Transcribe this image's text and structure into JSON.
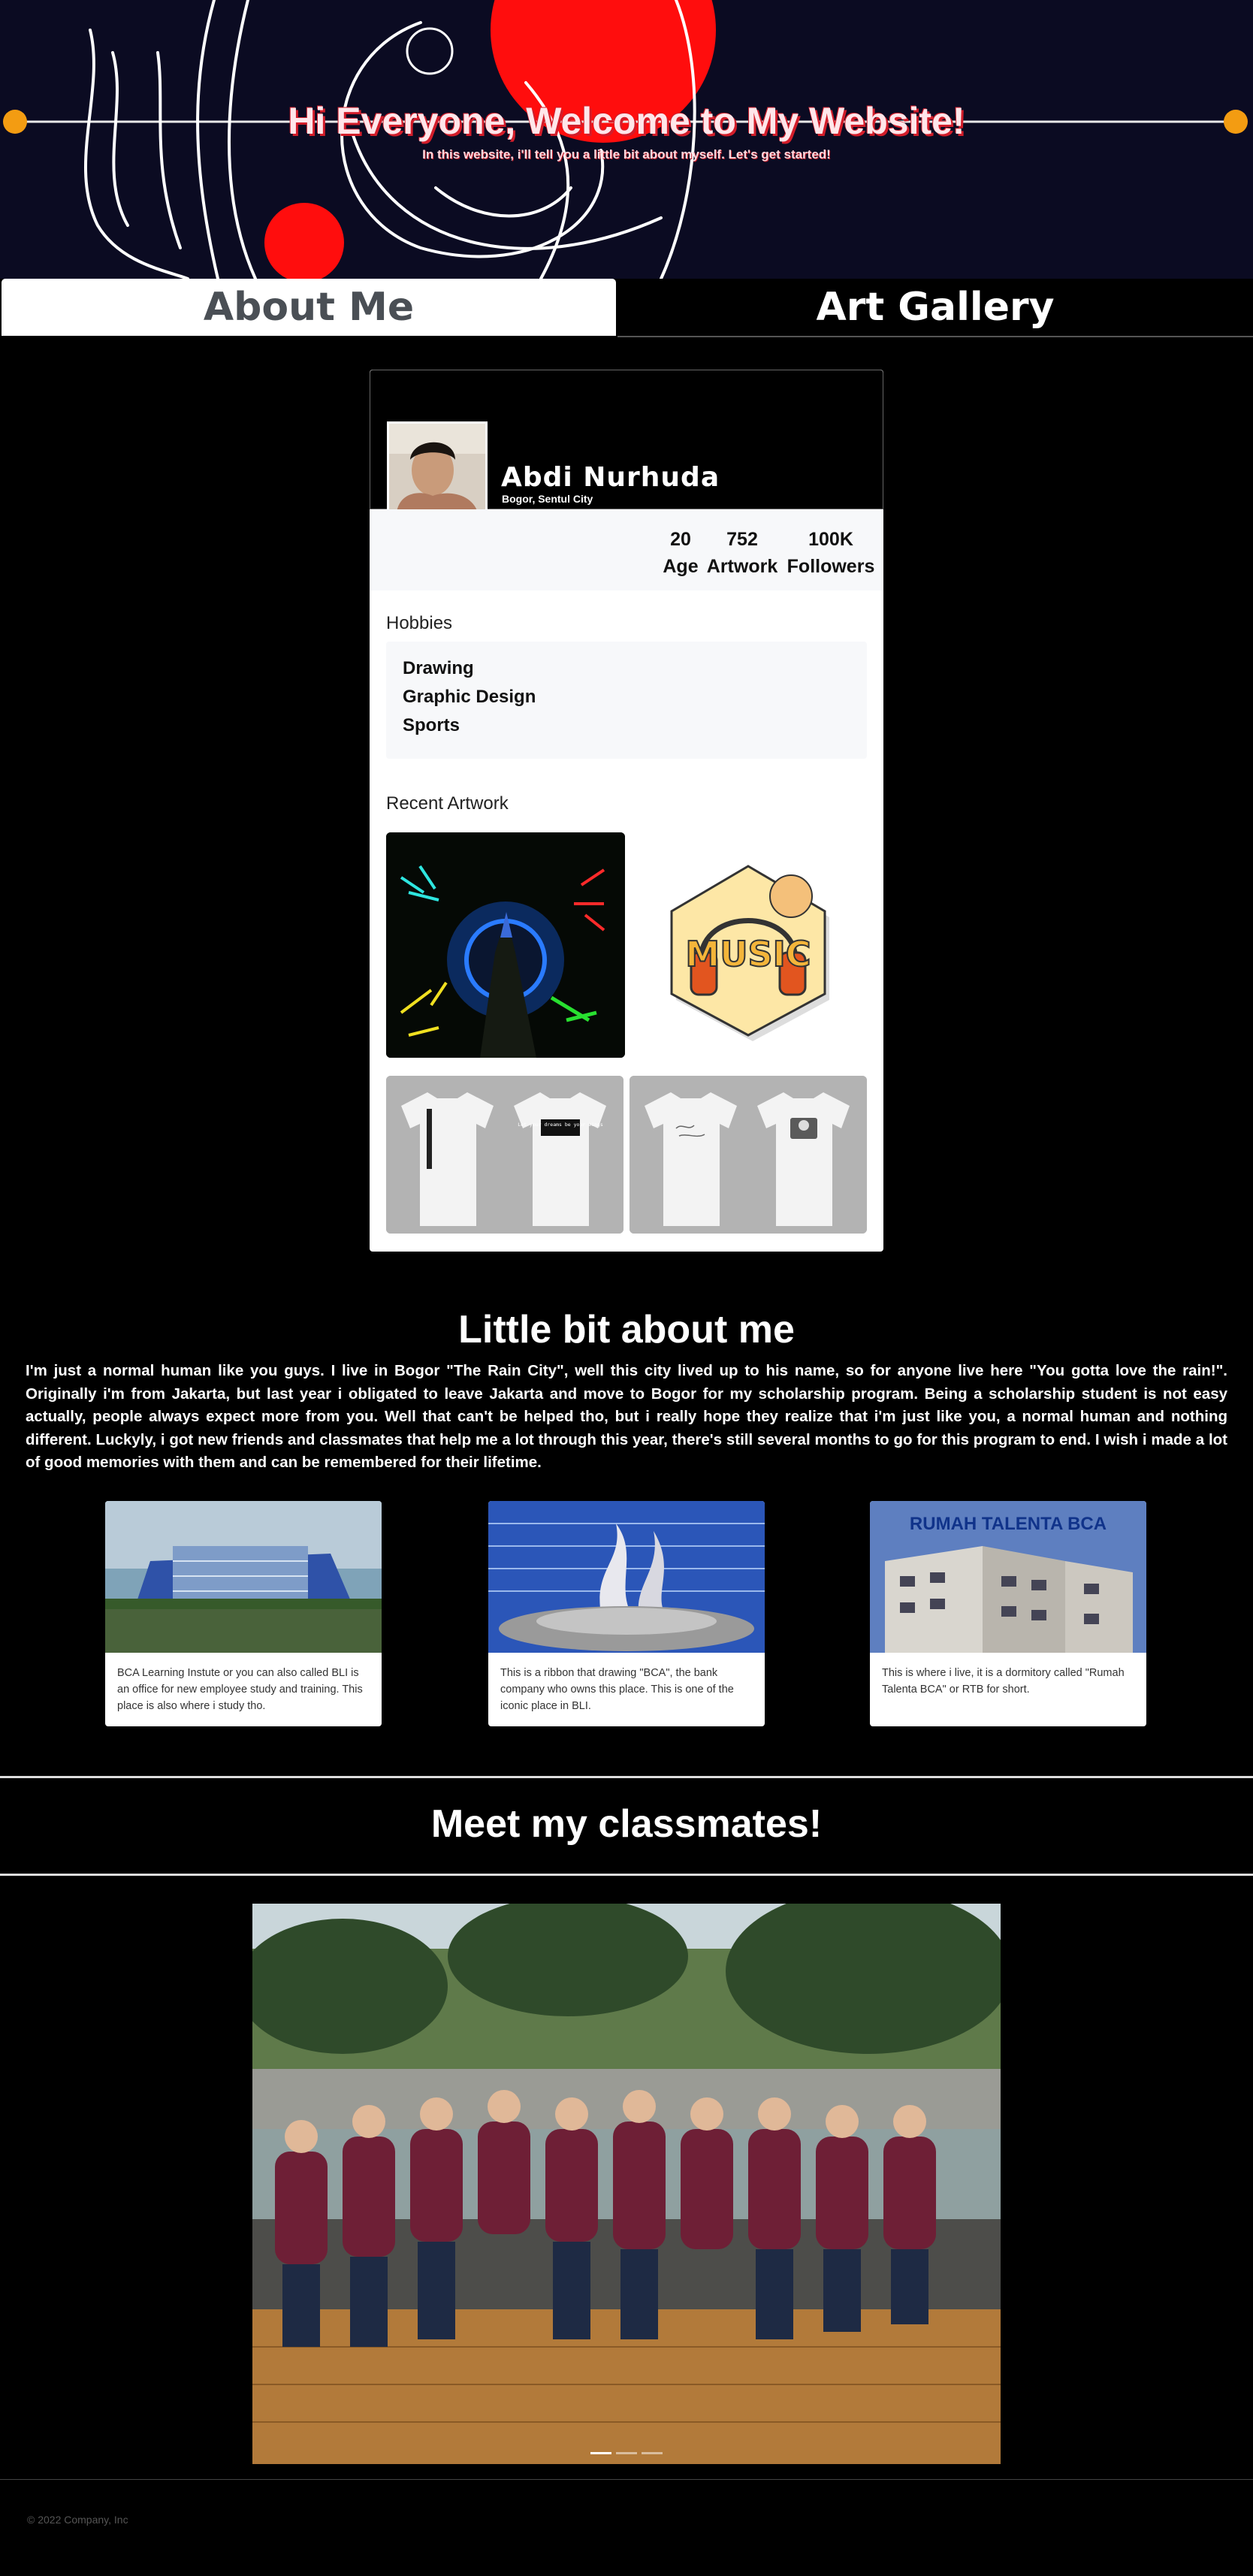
{
  "hero": {
    "title": "Hi Everyone, Welcome to My Website!",
    "subtitle": "In this website, i'll tell you a little bit about myself. Let's get started!"
  },
  "tabs": [
    {
      "label": "About Me",
      "active": true
    },
    {
      "label": "Art Gallery",
      "active": false
    }
  ],
  "profile": {
    "name": "Abdi Nurhuda",
    "location": "Bogor, Sentul City",
    "stats": [
      {
        "value": "20",
        "label": "Age"
      },
      {
        "value": "752",
        "label": "Artwork"
      },
      {
        "value": "100K",
        "label": "Followers"
      }
    ],
    "hobbies_label": "Hobbies",
    "hobbies": [
      "Drawing",
      "Graphic Design",
      "Sports"
    ],
    "recent_label": "Recent Artwork",
    "artwork_music_text": "MUSIC",
    "shirt_text": "Let your dreams be your wings"
  },
  "about": {
    "title": "Little bit about me",
    "text": "I'm just a normal human like you guys. I live in Bogor \"The Rain City\", well this city lived up to his name, so for anyone live here \"You gotta love the rain!\". Originally i'm from Jakarta, but last year i obligated to leave Jakarta and move to Bogor for my scholarship program. Being a scholarship student is not easy actually, people always expect more from you. Well that can't be helped tho, but i really hope they realize that i'm just like you, a normal human and nothing different. Luckyly, i got new friends and classmates that help me a lot through this year, there's still several months to go for this program to end. I wish i made a lot of good memories with them and can be remembered for their lifetime."
  },
  "places": [
    {
      "caption": "BCA Learning Instute or you can also called BLI is an office for new employee study and training. This place is also where i study tho."
    },
    {
      "caption": "This is a ribbon that drawing \"BCA\", the bank company who owns this place. This is one of the iconic place in BLI."
    },
    {
      "caption": "This is where i live, it is a dormitory called \"Rumah Talenta BCA\" or RTB for short.",
      "sign": "RUMAH TALENTA BCA"
    }
  ],
  "classmates": {
    "title": "Meet my classmates!",
    "slides": 3,
    "active_slide": 0
  },
  "footer": {
    "text": "© 2022 Company, Inc"
  },
  "colors": {
    "accent_red": "#ff0d0d",
    "accent_orange": "#f39c12",
    "hero_bg": "#0b0b22"
  }
}
